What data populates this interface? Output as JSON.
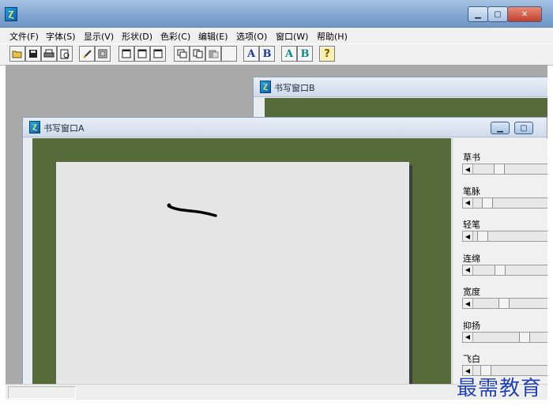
{
  "menu": [
    "文件(F)",
    "字体(S)",
    "显示(V)",
    "形状(D)",
    "色彩(C)",
    "编辑(E)",
    "选项(O)",
    "窗口(W)",
    "帮助(H)"
  ],
  "toolbar": {
    "buttons": [
      "open",
      "save",
      "print",
      "print-preview",
      "pen",
      "frame",
      "window-single",
      "window-double",
      "window-triple",
      "restore",
      "copy",
      "paste",
      "blank",
      "font-A",
      "font-B",
      "color-A",
      "color-B",
      "help"
    ],
    "letters": {
      "a1": "A",
      "b1": "B",
      "a2": "A",
      "b2": "B",
      "help": "?"
    }
  },
  "windows": {
    "window_b": {
      "title": "书写窗口B"
    },
    "window_a": {
      "title": "书写窗口A"
    }
  },
  "sliders": [
    {
      "label": "草书",
      "value": 0.3
    },
    {
      "label": "笔脉",
      "value": 0.12
    },
    {
      "label": "轻笔",
      "value": 0.05
    },
    {
      "label": "连绵",
      "value": 0.32
    },
    {
      "label": "宽度",
      "value": 0.38
    },
    {
      "label": "抑扬",
      "value": 0.7
    },
    {
      "label": "飞白",
      "value": 0.1
    }
  ],
  "watermark": "最需教育",
  "colors": {
    "mdi_bg": "#a9a9a9",
    "desk_green": "#556b3a",
    "sheet": "#e5e5e5",
    "title_blue": "#7fa4cf"
  }
}
